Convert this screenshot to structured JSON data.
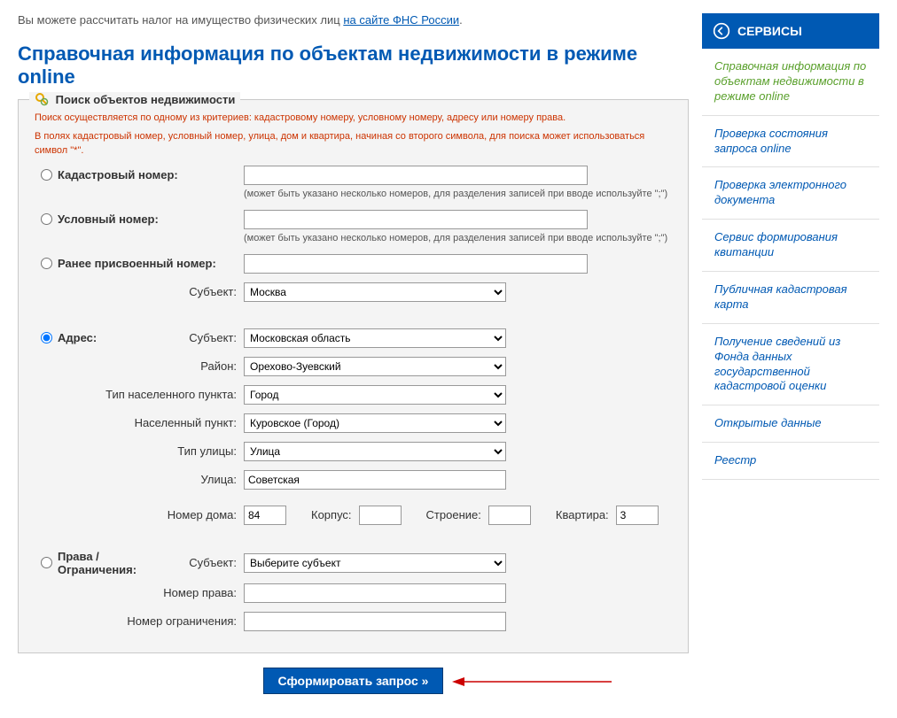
{
  "top_note": {
    "prefix": "Вы можете рассчитать налог на имущество физических лиц ",
    "link": "на сайте ФНС России",
    "suffix": "."
  },
  "page_title": "Справочная информация по объектам недвижимости в режиме online",
  "panel_title": "Поиск объектов недвижимости",
  "warn1": "Поиск осуществляется по одному из критериев: кадастровому номеру, условному номеру, адресу или номеру права.",
  "warn2": "В полях кадастровый номер, условный номер, улица, дом и квартира, начиная со второго символа, для поиска может использоваться символ \"*\".",
  "labels": {
    "kad": "Кадастровый номер:",
    "usl": "Условный номер:",
    "prev": "Ранее присвоенный номер:",
    "subj": "Субъект:",
    "addr": "Адрес:",
    "rayon": "Район:",
    "nptype": "Тип населенного пункта:",
    "np": "Населенный пункт:",
    "sttype": "Тип улицы:",
    "street": "Улица:",
    "house": "Номер дома:",
    "korpus": "Корпус:",
    "stro": "Строение:",
    "kv": "Квартира:",
    "rights": "Права / Ограничения:",
    "rightno": "Номер права:",
    "limitno": "Номер ограничения:"
  },
  "hints": {
    "multi": "(может быть указано несколько номеров, для разделения записей при вводе используйте \";\")"
  },
  "values": {
    "prev_subj": "Москва",
    "addr_subj": "Московская область",
    "rayon": "Орехово-Зуевский",
    "nptype": "Город",
    "np": "Куровское (Город)",
    "sttype": "Улица",
    "street": "Советская",
    "house": "84",
    "korpus": "",
    "stro": "",
    "kv": "3",
    "rights_subj": "Выберите субъект"
  },
  "submit": "Сформировать запрос »",
  "sidebar": {
    "header": "СЕРВИСЫ",
    "items": [
      "Справочная информация по объектам недвижимости в режиме online",
      "Проверка состояния запроса online",
      "Проверка электронного документа",
      "Сервис формирования квитанции",
      "Публичная кадастровая карта",
      "Получение сведений из Фонда данных государственной кадастровой оценки",
      "Открытые данные",
      "Реестр"
    ]
  }
}
